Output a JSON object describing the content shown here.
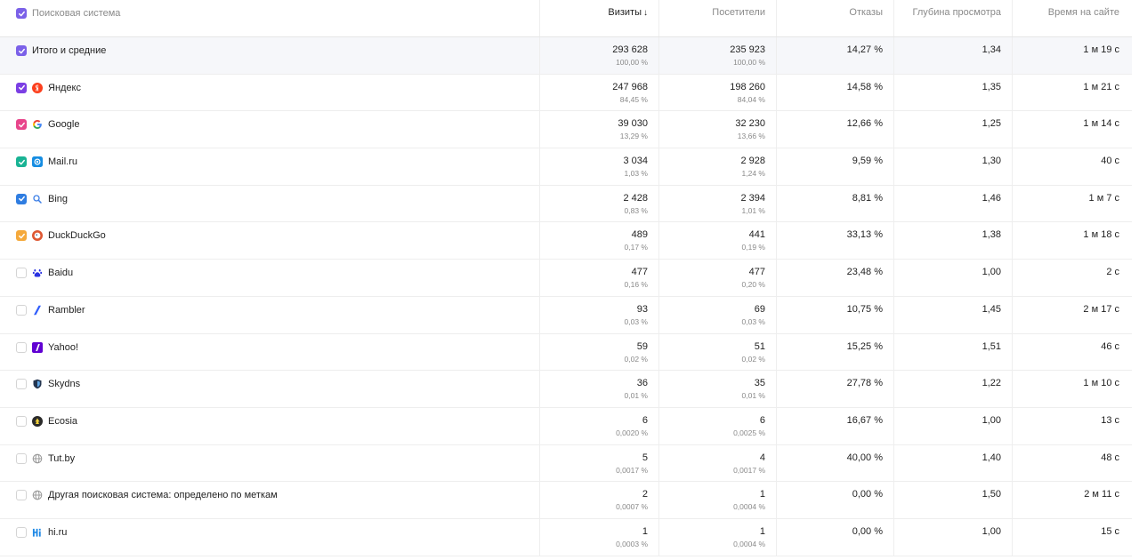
{
  "header": {
    "name": "Поисковая система",
    "visits": "Визиты",
    "sort_arrow": "↓",
    "visitors": "Посетители",
    "bounce": "Отказы",
    "depth": "Глубина просмотра",
    "time": "Время на сайте"
  },
  "colors": {
    "total": "#7b61e8",
    "yandex": "#7b3fe4",
    "google": "#e8458b",
    "mailru": "#19b394",
    "bing": "#2f7de1",
    "duckduckgo": "#f5a93b"
  },
  "rows": [
    {
      "name": "Итого и средние",
      "icon": "none",
      "checked": true,
      "visits": "293 628",
      "visits_pct": "100,00 %",
      "visitors": "235 923",
      "visitors_pct": "100,00 %",
      "bounce": "14,27 %",
      "depth": "1,34",
      "time": "1 м 19 с"
    },
    {
      "name": "Яндекс",
      "icon": "yandex-icon",
      "checked": true,
      "visits": "247 968",
      "visits_pct": "84,45 %",
      "visitors": "198 260",
      "visitors_pct": "84,04 %",
      "bounce": "14,58 %",
      "depth": "1,35",
      "time": "1 м 21 с"
    },
    {
      "name": "Google",
      "icon": "google-icon",
      "checked": true,
      "visits": "39 030",
      "visits_pct": "13,29 %",
      "visitors": "32 230",
      "visitors_pct": "13,66 %",
      "bounce": "12,66 %",
      "depth": "1,25",
      "time": "1 м 14 с"
    },
    {
      "name": "Mail.ru",
      "icon": "mailru-icon",
      "checked": true,
      "visits": "3 034",
      "visits_pct": "1,03 %",
      "visitors": "2 928",
      "visitors_pct": "1,24 %",
      "bounce": "9,59 %",
      "depth": "1,30",
      "time": "40 с"
    },
    {
      "name": "Bing",
      "icon": "bing-icon",
      "checked": true,
      "visits": "2 428",
      "visits_pct": "0,83 %",
      "visitors": "2 394",
      "visitors_pct": "1,01 %",
      "bounce": "8,81 %",
      "depth": "1,46",
      "time": "1 м 7 с"
    },
    {
      "name": "DuckDuckGo",
      "icon": "duckduckgo-icon",
      "checked": true,
      "visits": "489",
      "visits_pct": "0,17 %",
      "visitors": "441",
      "visitors_pct": "0,19 %",
      "bounce": "33,13 %",
      "depth": "1,38",
      "time": "1 м 18 с"
    },
    {
      "name": "Baidu",
      "icon": "baidu-icon",
      "checked": false,
      "visits": "477",
      "visits_pct": "0,16 %",
      "visitors": "477",
      "visitors_pct": "0,20 %",
      "bounce": "23,48 %",
      "depth": "1,00",
      "time": "2 с"
    },
    {
      "name": "Rambler",
      "icon": "rambler-icon",
      "checked": false,
      "visits": "93",
      "visits_pct": "0,03 %",
      "visitors": "69",
      "visitors_pct": "0,03 %",
      "bounce": "10,75 %",
      "depth": "1,45",
      "time": "2 м 17 с"
    },
    {
      "name": "Yahoo!",
      "icon": "yahoo-icon",
      "checked": false,
      "visits": "59",
      "visits_pct": "0,02 %",
      "visitors": "51",
      "visitors_pct": "0,02 %",
      "bounce": "15,25 %",
      "depth": "1,51",
      "time": "46 с"
    },
    {
      "name": "Skydns",
      "icon": "skydns-icon",
      "checked": false,
      "visits": "36",
      "visits_pct": "0,01 %",
      "visitors": "35",
      "visitors_pct": "0,01 %",
      "bounce": "27,78 %",
      "depth": "1,22",
      "time": "1 м 10 с"
    },
    {
      "name": "Ecosia",
      "icon": "ecosia-icon",
      "checked": false,
      "visits": "6",
      "visits_pct": "0,0020 %",
      "visitors": "6",
      "visitors_pct": "0,0025 %",
      "bounce": "16,67 %",
      "depth": "1,00",
      "time": "13 с"
    },
    {
      "name": "Tut.by",
      "icon": "globe-icon",
      "checked": false,
      "visits": "5",
      "visits_pct": "0,0017 %",
      "visitors": "4",
      "visitors_pct": "0,0017 %",
      "bounce": "40,00 %",
      "depth": "1,40",
      "time": "48 с"
    },
    {
      "name": "Другая поисковая система: определено по меткам",
      "icon": "globe-icon",
      "checked": false,
      "visits": "2",
      "visits_pct": "0,0007 %",
      "visitors": "1",
      "visitors_pct": "0,0004 %",
      "bounce": "0,00 %",
      "depth": "1,50",
      "time": "2 м 11 с"
    },
    {
      "name": "hi.ru",
      "icon": "hiru-icon",
      "checked": false,
      "visits": "1",
      "visits_pct": "0,0003 %",
      "visitors": "1",
      "visitors_pct": "0,0004 %",
      "bounce": "0,00 %",
      "depth": "1,00",
      "time": "15 с"
    }
  ]
}
